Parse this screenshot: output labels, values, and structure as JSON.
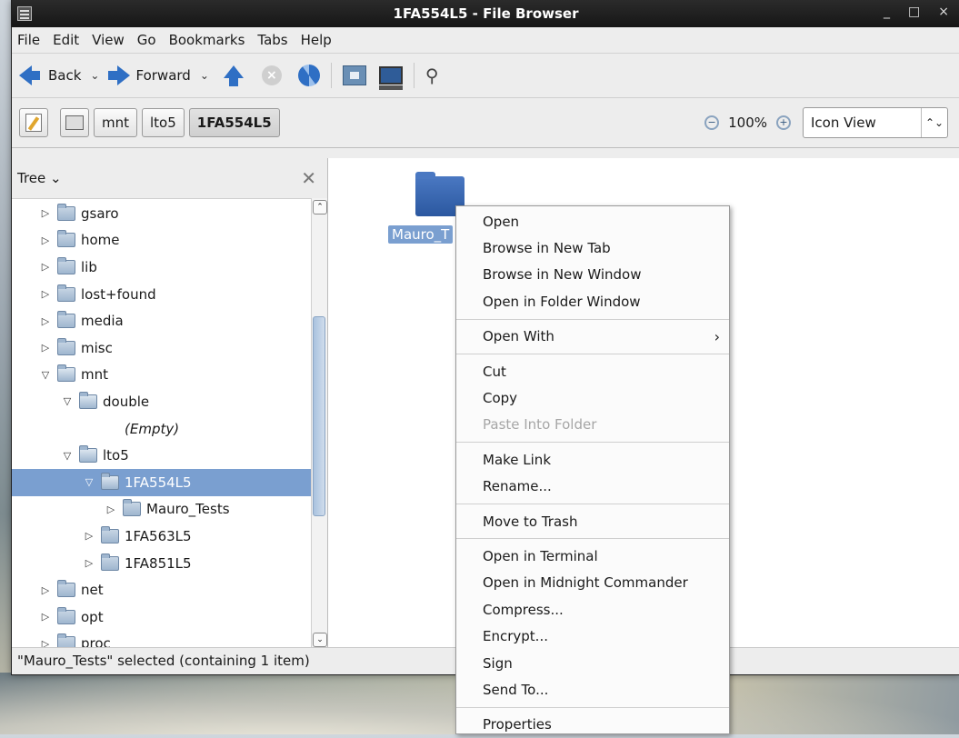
{
  "window": {
    "title": "1FA554L5 - File Browser",
    "controls": [
      "_",
      "□",
      "×"
    ]
  },
  "menubar": {
    "items": [
      {
        "label": "File"
      },
      {
        "label": "Edit"
      },
      {
        "label": "View"
      },
      {
        "label": "Go"
      },
      {
        "label": "Bookmarks"
      },
      {
        "label": "Tabs"
      },
      {
        "label": "Help"
      }
    ]
  },
  "toolbar": {
    "back_label": "Back",
    "forward_label": "Forward"
  },
  "location": {
    "path": [
      "mnt",
      "lto5",
      "1FA554L5"
    ],
    "zoom": "100%",
    "view": "Icon View"
  },
  "sidebar": {
    "title": "Tree",
    "rows": [
      {
        "label": "gsaro",
        "indent": 0,
        "exp": "▷",
        "folder": true
      },
      {
        "label": "home",
        "indent": 0,
        "exp": "▷",
        "folder": true
      },
      {
        "label": "lib",
        "indent": 0,
        "exp": "▷",
        "folder": true
      },
      {
        "label": "lost+found",
        "indent": 0,
        "exp": "▷",
        "folder": true
      },
      {
        "label": "media",
        "indent": 0,
        "exp": "▷",
        "folder": true
      },
      {
        "label": "misc",
        "indent": 0,
        "exp": "▷",
        "folder": true
      },
      {
        "label": "mnt",
        "indent": 0,
        "exp": "▽",
        "folder": true,
        "open": true
      },
      {
        "label": "double",
        "indent": 1,
        "exp": "▽",
        "folder": true,
        "open": true
      },
      {
        "label": "(Empty)",
        "indent": 2,
        "exp": "",
        "folder": false,
        "empty": true
      },
      {
        "label": "lto5",
        "indent": 1,
        "exp": "▽",
        "folder": true,
        "open": true
      },
      {
        "label": "1FA554L5",
        "indent": 2,
        "exp": "▽",
        "folder": true,
        "open": true,
        "selected": true
      },
      {
        "label": "Mauro_Tests",
        "indent": 3,
        "exp": "▷",
        "folder": true
      },
      {
        "label": "1FA563L5",
        "indent": 2,
        "exp": "▷",
        "folder": true
      },
      {
        "label": "1FA851L5",
        "indent": 2,
        "exp": "▷",
        "folder": true
      },
      {
        "label": "net",
        "indent": 0,
        "exp": "▷",
        "folder": true
      },
      {
        "label": "opt",
        "indent": 0,
        "exp": "▷",
        "folder": true
      },
      {
        "label": "proc",
        "indent": 0,
        "exp": "▷",
        "folder": true
      }
    ]
  },
  "main": {
    "folder_label": "Mauro_T"
  },
  "status": {
    "text": "\"Mauro_Tests\" selected (containing 1 item)"
  },
  "context_menu": {
    "items": [
      {
        "label": "Open"
      },
      {
        "label": "Browse in New Tab"
      },
      {
        "label": "Browse in New Window"
      },
      {
        "label": "Open in Folder Window"
      },
      {
        "sep": true
      },
      {
        "label": "Open With",
        "submenu": true
      },
      {
        "sep": true
      },
      {
        "label": "Cut"
      },
      {
        "label": "Copy"
      },
      {
        "label": "Paste Into Folder",
        "disabled": true
      },
      {
        "sep": true
      },
      {
        "label": "Make Link"
      },
      {
        "label": "Rename..."
      },
      {
        "sep": true
      },
      {
        "label": "Move to Trash"
      },
      {
        "sep": true
      },
      {
        "label": "Open in Terminal"
      },
      {
        "label": "Open in Midnight Commander"
      },
      {
        "label": "Compress..."
      },
      {
        "label": "Encrypt..."
      },
      {
        "label": "Sign"
      },
      {
        "label": "Send To..."
      },
      {
        "sep": true
      },
      {
        "label": "Properties"
      }
    ]
  }
}
